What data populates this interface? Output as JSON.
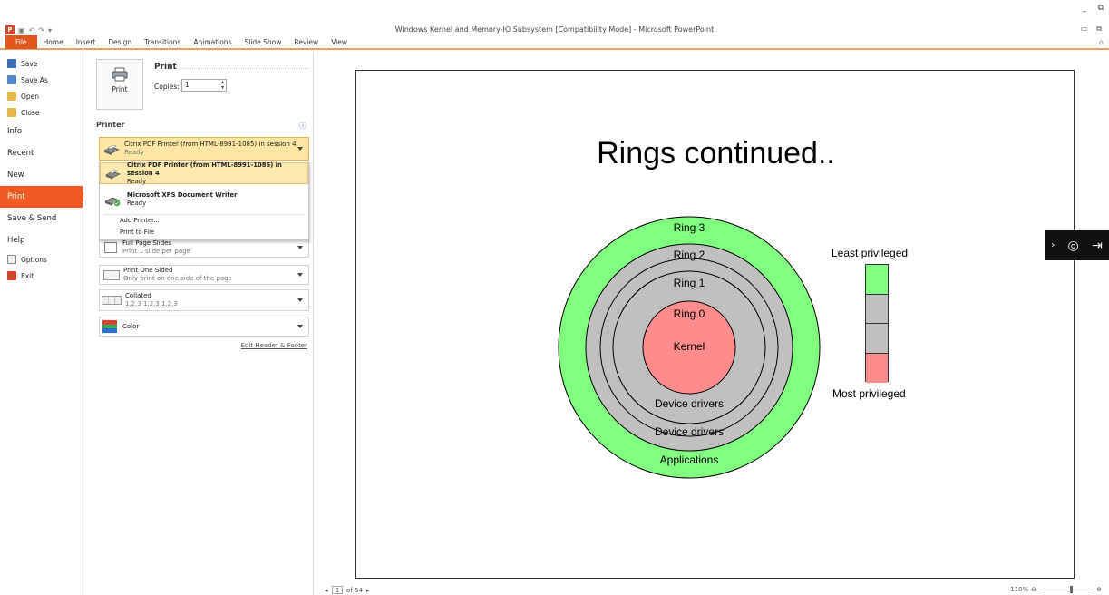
{
  "window": {
    "title": "Windows Kernel and Memory-IO Subsystem [Compatibility Mode]  -  Microsoft PowerPoint",
    "app_icon": "P",
    "top_controls": [
      "_",
      " □"
    ],
    "controls": [
      "–",
      "□",
      "×"
    ]
  },
  "qat": {
    "items": [
      "save-icon",
      "undo-icon",
      "redo-icon",
      "customize-icon"
    ]
  },
  "ribbon": {
    "tabs": [
      "File",
      "Home",
      "Insert",
      "Design",
      "Transitions",
      "Animations",
      "Slide Show",
      "Review",
      "View"
    ]
  },
  "backstage_menu": {
    "items": [
      {
        "label": "Save",
        "icon": "save-icon",
        "kind": "small"
      },
      {
        "label": "Save As",
        "icon": "save-as-icon",
        "kind": "small"
      },
      {
        "label": "Open",
        "icon": "open-folder-icon",
        "kind": "small"
      },
      {
        "label": "Close",
        "icon": "close-folder-icon",
        "kind": "small"
      },
      {
        "label": "Info",
        "kind": "big"
      },
      {
        "label": "Recent",
        "kind": "big"
      },
      {
        "label": "New",
        "kind": "big"
      },
      {
        "label": "Print",
        "kind": "big",
        "active": true
      },
      {
        "label": "Save & Send",
        "kind": "big"
      },
      {
        "label": "Help",
        "kind": "big"
      },
      {
        "label": "Options",
        "icon": "options-icon",
        "kind": "small"
      },
      {
        "label": "Exit",
        "icon": "exit-icon",
        "kind": "small"
      }
    ]
  },
  "print": {
    "heading": "Print",
    "button_label": "Print",
    "copies_label": "Copies:",
    "copies_value": "1"
  },
  "printer": {
    "section_label": "Printer",
    "selected_name": "Citrix PDF Printer (from HTML-8991-1085) in session 4",
    "selected_status": "Ready",
    "options": [
      {
        "name": "Citrix PDF Printer (from HTML-8991-1085) in session 4",
        "status": "Ready"
      },
      {
        "name": "Microsoft XPS Document Writer",
        "status": "Ready"
      }
    ],
    "links": [
      "Add Printer...",
      "Print to File"
    ]
  },
  "settings": {
    "slides": {
      "title": "Full Page Slides",
      "sub": "Print 1 slide per page"
    },
    "sided": {
      "title": "Print One Sided",
      "sub": "Only print on one side of the page"
    },
    "collated": {
      "title": "Collated",
      "sub": "1,2,3   1,2,3   1,2,3"
    },
    "color": {
      "title": "Color"
    },
    "edit_header_footer": "Edit Header & Footer"
  },
  "slide": {
    "title": "Rings continued..",
    "ring_labels": {
      "ring3": "Ring 3",
      "ring2": "Ring 2",
      "ring1": "Ring 1",
      "ring0": "Ring 0",
      "kernel": "Kernel",
      "device_drivers_inner": "Device drivers",
      "device_drivers_outer": "Device drivers",
      "applications": "Applications"
    },
    "legend": {
      "top": "Least privileged",
      "bottom": "Most privileged",
      "colors": [
        "#80ff80",
        "#c0c0c0",
        "#c0c0c0",
        "#ff8c8c"
      ]
    },
    "colors": {
      "green": "#80ff80",
      "grey": "#c0c0c0",
      "red": "#ff8c8c"
    }
  },
  "status": {
    "page_current": "3",
    "page_total": "of 54",
    "zoom": "110%"
  },
  "accent": {
    "file_tab": "#e2571e",
    "active_menu": "#f05a22",
    "selected_printer": "#fde6a3"
  }
}
